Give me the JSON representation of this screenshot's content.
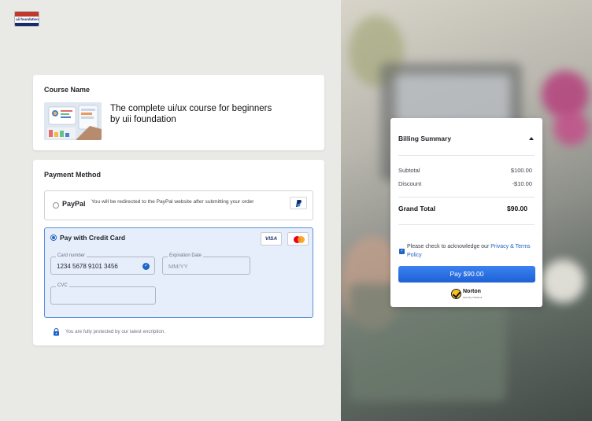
{
  "brand": {
    "logo_text": "uii foundation"
  },
  "course": {
    "section_title": "Course Name",
    "title": "The complete ui/ux course for beginners by uii foundation",
    "thumbnail_icon": "course-thumbnail-image"
  },
  "payment": {
    "section_title": "Payment Method",
    "paypal": {
      "label": "PayPal",
      "description": "You will be redirected to the PayPal website after submitting your order",
      "badge_icon": "paypal-logo-icon"
    },
    "credit_card": {
      "label": "Pay with Credit Card",
      "visa_label": "VISA",
      "selected": true,
      "card_number_label": "Card number",
      "card_number_value": "1234 5678 9101 3456",
      "expiry_label": "Expiration Date",
      "expiry_placeholder": "MM/YY",
      "cvc_label": "CVC",
      "cvc_value": ""
    },
    "secure_note": "You are fully protected by our latest encription."
  },
  "billing": {
    "title": "Billing Summary",
    "rows": [
      {
        "label": "Subtotal",
        "amount": "$100.00"
      },
      {
        "label": "Discount",
        "amount": "-$10.00"
      }
    ],
    "grand_total_label": "Grand Total",
    "grand_total_amount": "$90.00",
    "acknowledge_prefix": "Please check to acknowledge our ",
    "acknowledge_link": "Privacy & Terms Policy",
    "acknowledge_checked": true,
    "pay_button_label": "Pay $90.00",
    "norton_label": "Norton",
    "norton_sub": "Security Checkout"
  },
  "colors": {
    "accent": "#1f63c7",
    "selected_bg": "#e6eefb",
    "page_bg": "#e9eae6"
  }
}
